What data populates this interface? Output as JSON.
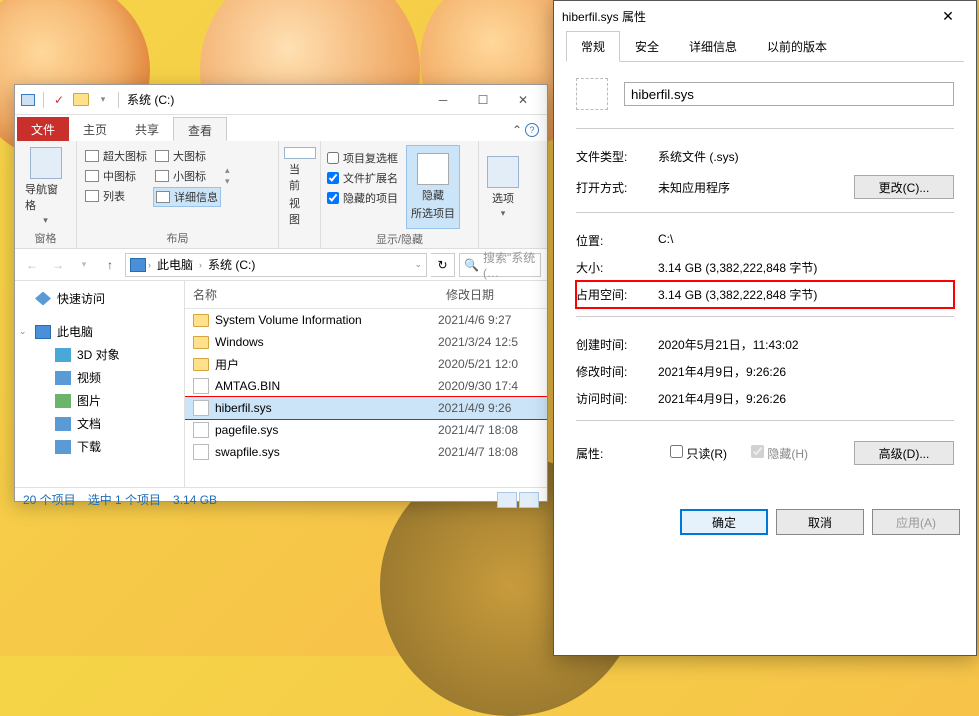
{
  "explorer": {
    "title": "系统 (C:)",
    "tabs": {
      "file": "文件",
      "home": "主页",
      "share": "共享",
      "view": "查看"
    },
    "ribbon": {
      "pane": {
        "btn": "导航窗格",
        "group": "窗格"
      },
      "layout": {
        "xl": "超大图标",
        "lg": "大图标",
        "md": "中图标",
        "sm": "小图标",
        "list": "列表",
        "details": "详细信息",
        "group": "布局"
      },
      "current_view": {
        "sort": "当前",
        "btn": "视图"
      },
      "showhide": {
        "checkboxes": "项目复选框",
        "ext": "文件扩展名",
        "hidden": "隐藏的项目",
        "hide_btn1": "隐藏",
        "hide_btn2": "所选项目",
        "group": "显示/隐藏"
      },
      "options": "选项"
    },
    "breadcrumb": {
      "pc": "此电脑",
      "drive": "系统 (C:)"
    },
    "search_placeholder": "搜索\"系统 (…",
    "cols": {
      "name": "名称",
      "date": "修改日期"
    },
    "nav": {
      "quick": "快速访问",
      "pc": "此电脑",
      "d3": "3D 对象",
      "video": "视频",
      "pic": "图片",
      "doc": "文档",
      "dl": "下载"
    },
    "files": [
      {
        "name": "System Volume Information",
        "type": "folder",
        "date": "2021/4/6 9:27"
      },
      {
        "name": "Windows",
        "type": "folder",
        "date": "2021/3/24 12:5"
      },
      {
        "name": "用户",
        "type": "folder",
        "date": "2020/5/21 12:0"
      },
      {
        "name": "AMTAG.BIN",
        "type": "file",
        "date": "2020/9/30 17:4"
      },
      {
        "name": "hiberfil.sys",
        "type": "file",
        "date": "2021/4/9 9:26",
        "selected": true
      },
      {
        "name": "pagefile.sys",
        "type": "file",
        "date": "2021/4/7 18:08"
      },
      {
        "name": "swapfile.sys",
        "type": "file",
        "date": "2021/4/7 18:08"
      }
    ],
    "status": {
      "count": "20 个项目",
      "sel": "选中 1 个项目",
      "size": "3.14 GB"
    }
  },
  "props": {
    "title": "hiberfil.sys 属性",
    "tabs": {
      "general": "常规",
      "security": "安全",
      "details": "详细信息",
      "prev": "以前的版本"
    },
    "filename": "hiberfil.sys",
    "rows": {
      "filetype_l": "文件类型:",
      "filetype_v": "系统文件 (.sys)",
      "opens_l": "打开方式:",
      "opens_v": "未知应用程序",
      "change": "更改(C)...",
      "loc_l": "位置:",
      "loc_v": "C:\\",
      "size_l": "大小:",
      "size_v": "3.14 GB (3,382,222,848 字节)",
      "disk_l": "占用空间:",
      "disk_v": "3.14 GB (3,382,222,848 字节)",
      "created_l": "创建时间:",
      "created_v": "2020年5月21日，11:43:02",
      "modified_l": "修改时间:",
      "modified_v": "2021年4月9日，9:26:26",
      "accessed_l": "访问时间:",
      "accessed_v": "2021年4月9日，9:26:26",
      "attr_l": "属性:",
      "readonly": "只读(R)",
      "hidden": "隐藏(H)",
      "advanced": "高级(D)..."
    },
    "buttons": {
      "ok": "确定",
      "cancel": "取消",
      "apply": "应用(A)"
    }
  }
}
